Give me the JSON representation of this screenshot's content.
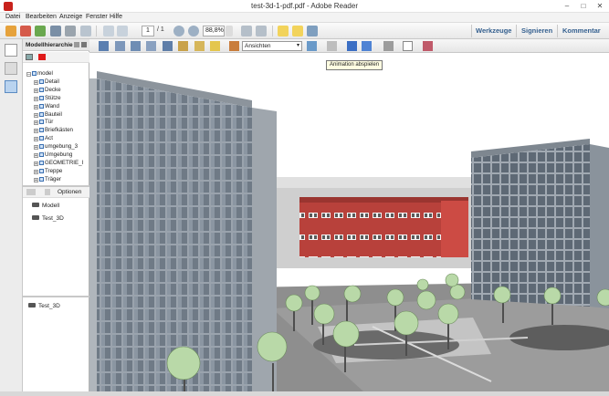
{
  "window": {
    "title": "test-3d-1-pdf.pdf - Adobe Reader",
    "minimize": "–",
    "maximize": "□",
    "close": "✕"
  },
  "menu": [
    "Datei",
    "Bearbeiten",
    "Anzeige",
    "Fenster",
    "Hilfe"
  ],
  "toolbar": {
    "page_current": "1",
    "page_total": "/ 1",
    "zoom": "88,8%",
    "tools_label": "Werkzeuge",
    "sign_label": "Signieren",
    "comment_label": "Kommentar"
  },
  "left_panel": {
    "title": "Modellhierarchie",
    "tree": [
      {
        "label": "model",
        "expand": "–",
        "root": true
      },
      {
        "label": "Detail",
        "expand": "+"
      },
      {
        "label": "Decke",
        "expand": "+"
      },
      {
        "label": "Stütze",
        "expand": "+"
      },
      {
        "label": "Wand",
        "expand": "+"
      },
      {
        "label": "Bauteil",
        "expand": "+"
      },
      {
        "label": "Tür",
        "expand": "+"
      },
      {
        "label": "Briefkästen",
        "expand": "+"
      },
      {
        "label": "Act",
        "expand": "+"
      },
      {
        "label": "umgebung_3",
        "expand": "+"
      },
      {
        "label": "Umgebung",
        "expand": "+"
      },
      {
        "label": "GEOMETRIE_I",
        "expand": "+"
      },
      {
        "label": "Treppe",
        "expand": "+"
      },
      {
        "label": "Träger",
        "expand": "+"
      }
    ],
    "options_label": "Optionen",
    "views": [
      "Modell",
      "Test_3D"
    ],
    "selected_view": "Test_3D"
  },
  "toolbar3d": {
    "views_dropdown": "Ansichten",
    "tooltip": "Animation abspielen"
  },
  "colors": {
    "accent": "#35608f",
    "brand": "#c8221c",
    "brick": "#b8413b"
  }
}
